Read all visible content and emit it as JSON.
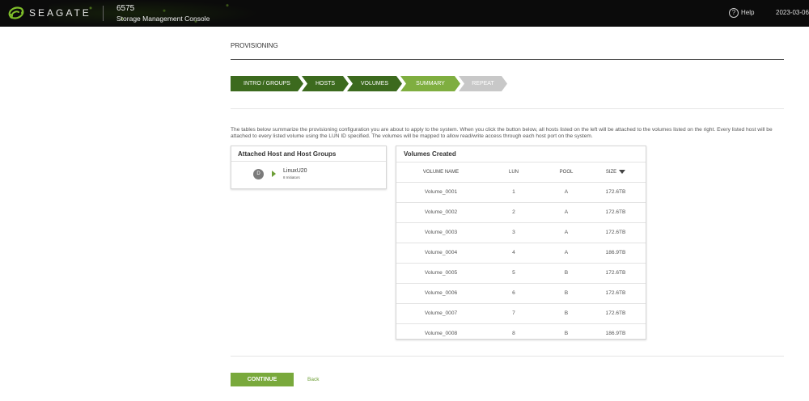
{
  "header": {
    "brand": "SEAGATE",
    "system_name": "6575",
    "console_name": "Storage Management Console",
    "help_label": "Help",
    "date": "2023-03-06"
  },
  "page": {
    "title": "PROVISIONING"
  },
  "wizard": {
    "steps": [
      {
        "label": "INTRO / GROUPS",
        "state": "done"
      },
      {
        "label": "HOSTS",
        "state": "done"
      },
      {
        "label": "VOLUMES",
        "state": "done"
      },
      {
        "label": "SUMMARY",
        "state": "active"
      },
      {
        "label": "REPEAT",
        "state": "pending"
      }
    ]
  },
  "intro_text": "The tables below summarize the provisioning configuration you are about to apply to the system. When you click the button below, all hosts listed on the left will be attached to the volumes listed on the right. Every listed host will be attached to every listed volume using the LUN ID specified. The volumes will be mapped to allow read/write access through each host port on the system.",
  "hosts_panel": {
    "title": "Attached Host and Host Groups",
    "host": {
      "icon_letter": "D",
      "name": "LinuxU20",
      "initiators": "8 Initiators"
    }
  },
  "volumes_panel": {
    "title": "Volumes Created",
    "columns": [
      "VOLUME NAME",
      "LUN",
      "POOL",
      "SIZE"
    ],
    "rows": [
      {
        "name": "Volume_0001",
        "lun": "1",
        "pool": "A",
        "size": "172.6TB"
      },
      {
        "name": "Volume_0002",
        "lun": "2",
        "pool": "A",
        "size": "172.6TB"
      },
      {
        "name": "Volume_0003",
        "lun": "3",
        "pool": "A",
        "size": "172.6TB"
      },
      {
        "name": "Volume_0004",
        "lun": "4",
        "pool": "A",
        "size": "186.9TB"
      },
      {
        "name": "Volume_0005",
        "lun": "5",
        "pool": "B",
        "size": "172.6TB"
      },
      {
        "name": "Volume_0006",
        "lun": "6",
        "pool": "B",
        "size": "172.6TB"
      },
      {
        "name": "Volume_0007",
        "lun": "7",
        "pool": "B",
        "size": "172.6TB"
      },
      {
        "name": "Volume_0008",
        "lun": "8",
        "pool": "B",
        "size": "186.9TB"
      }
    ]
  },
  "actions": {
    "continue_label": "CONTINUE",
    "back_label": "Back"
  },
  "colors": {
    "accent": "#79a93c",
    "step_done": "#3c6a1e",
    "step_active": "#7fae40",
    "step_pending": "#c8c8c8"
  }
}
